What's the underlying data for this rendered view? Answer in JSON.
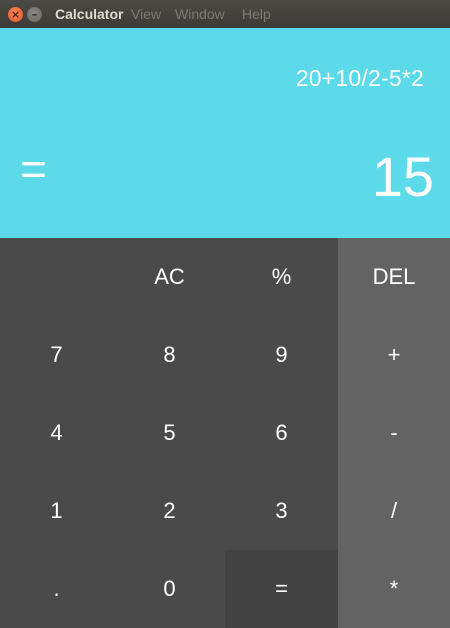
{
  "window": {
    "title": "Calculator",
    "close_glyph": "×",
    "minimize_glyph": "–",
    "menu": [
      "View",
      "Window",
      "Help"
    ]
  },
  "display": {
    "expression": "20+10/2-5*2",
    "equals_symbol": "=",
    "result": "15"
  },
  "keys": {
    "row1": [
      "",
      "AC",
      "%",
      "DEL"
    ],
    "row2": [
      "7",
      "8",
      "9",
      "+"
    ],
    "row3": [
      "4",
      "5",
      "6",
      "-"
    ],
    "row4": [
      "1",
      "2",
      "3",
      "/"
    ],
    "row5": [
      ".",
      "0",
      "=",
      "*"
    ]
  },
  "colors": {
    "display_bg": "#5ddaea",
    "keypad_bg": "#4a4a4a",
    "operator_bg": "#636363",
    "pressed_bg": "#434343",
    "text": "#ffffff"
  }
}
